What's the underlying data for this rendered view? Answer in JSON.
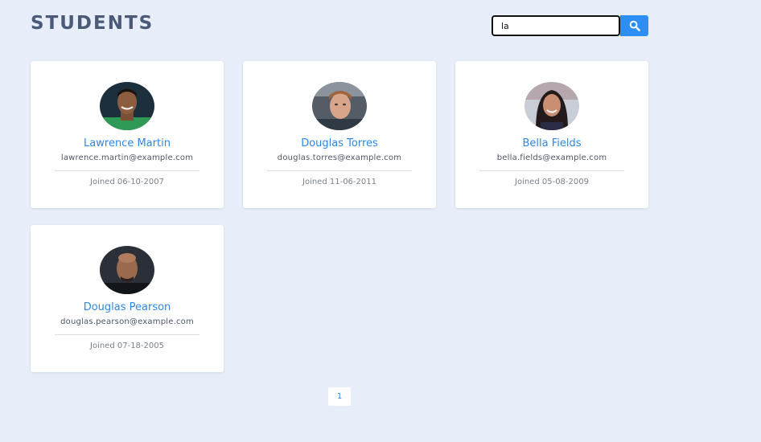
{
  "header": {
    "title": "STUDENTS"
  },
  "search": {
    "value": "la",
    "icon": "search-icon",
    "button_color": "#2d8ef3"
  },
  "students": [
    {
      "name": "Lawrence Martin",
      "email": "lawrence.martin@example.com",
      "joined": "Joined 06-10-2007",
      "avatar": "avatar-photo"
    },
    {
      "name": "Douglas Torres",
      "email": "douglas.torres@example.com",
      "joined": "Joined 11-06-2011",
      "avatar": "avatar-photo"
    },
    {
      "name": "Bella Fields",
      "email": "bella.fields@example.com",
      "joined": "Joined 05-08-2009",
      "avatar": "avatar-photo"
    },
    {
      "name": "Douglas Pearson",
      "email": "douglas.pearson@example.com",
      "joined": "Joined 07-18-2005",
      "avatar": "avatar-photo"
    }
  ],
  "pagination": {
    "current_page": "1"
  },
  "colors": {
    "background": "#e8eef9",
    "title": "#4a5a78",
    "accent": "#2d86e8"
  }
}
